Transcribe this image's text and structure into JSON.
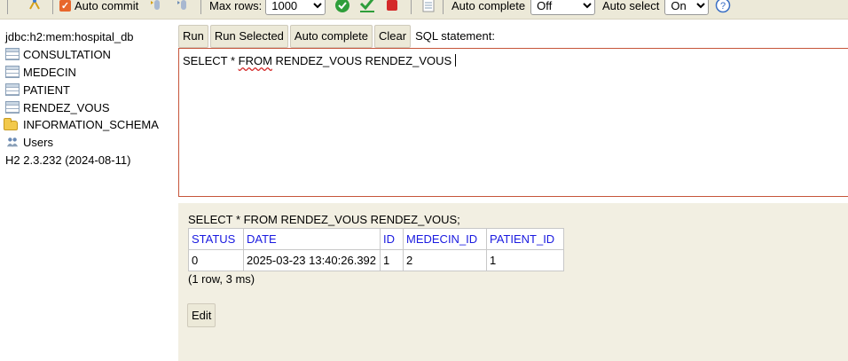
{
  "toolbar": {
    "auto_commit_label": "Auto commit",
    "max_rows_label": "Max rows:",
    "max_rows_value": "1000",
    "auto_complete_label": "Auto complete",
    "auto_complete_value": "Off",
    "auto_select_label": "Auto select",
    "auto_select_value": "On"
  },
  "tree": {
    "connection": "jdbc:h2:mem:hospital_db",
    "tables": [
      "CONSULTATION",
      "MEDECIN",
      "PATIENT",
      "RENDEZ_VOUS"
    ],
    "schema": "INFORMATION_SCHEMA",
    "users": "Users",
    "version": "H2 2.3.232 (2024-08-11)"
  },
  "query": {
    "run_label": "Run",
    "run_selected_label": "Run Selected",
    "auto_complete_label": "Auto complete",
    "clear_label": "Clear",
    "statement_label": "SQL statement:",
    "sql_select": "SELECT *",
    "sql_from": "FROM",
    "sql_rest": "RENDEZ_VOUS RENDEZ_VOUS"
  },
  "result": {
    "sql": "SELECT * FROM RENDEZ_VOUS RENDEZ_VOUS;",
    "columns": [
      "STATUS",
      "DATE",
      "ID",
      "MEDECIN_ID",
      "PATIENT_ID"
    ],
    "rows": [
      [
        "0",
        "2025-03-23 13:40:26.392",
        "1",
        "2",
        "1"
      ]
    ],
    "row_count": "(1 row, 3 ms)",
    "edit_label": "Edit"
  },
  "colors": {
    "toolbar_bg": "#ece9d8",
    "results_bg": "#f2efe2",
    "column_header": "#1a1ae0",
    "editor_border": "#c6553a"
  }
}
